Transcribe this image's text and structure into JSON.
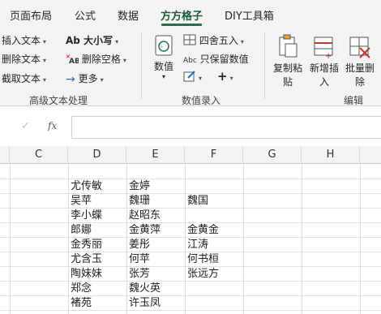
{
  "tabs": [
    "页面布局",
    "公式",
    "数据",
    "方方格子",
    "DIY工具箱"
  ],
  "ribbon": {
    "text_group": {
      "insert_text": "插入文本",
      "delete_text": "删除文本",
      "cut_text": "截取文本",
      "case_label": "Ab 大小写",
      "delete_space": "删除空格",
      "more": "更多",
      "group_label": "高级文本处理"
    },
    "numeric_group": {
      "value_label": "数值",
      "round_label": "四舍五入",
      "keep_value": "只保留数值",
      "group_label": "数值录入"
    },
    "edit_group": {
      "copy_paste": "复制粘",
      "copy_paste2": "贴",
      "add_insert": "新增插",
      "add_insert2": "入",
      "batch_delete": "批量删",
      "batch_delete2": "除",
      "group_label": "编辑"
    }
  },
  "formula_bar": {
    "cancel": "✓",
    "fx": "fx",
    "value": ""
  },
  "columns": [
    "C",
    "D",
    "E",
    "F",
    "G",
    "H"
  ],
  "rows": [
    [
      "",
      "尤传敏",
      "金婷",
      "",
      "",
      ""
    ],
    [
      "",
      "吴苹",
      "魏珊",
      "魏国",
      "",
      ""
    ],
    [
      "",
      "李小蝶",
      "赵昭东",
      "",
      "",
      ""
    ],
    [
      "",
      "郎娜",
      "金黄萍",
      "金黄金",
      "",
      ""
    ],
    [
      "",
      "金秀丽",
      "姜彤",
      "江涛",
      "",
      ""
    ],
    [
      "",
      "尤含玉",
      "何苹",
      "何书桓",
      "",
      ""
    ],
    [
      "",
      "陶妹妹",
      "张芳",
      "张远方",
      "",
      ""
    ],
    [
      "",
      "郑念",
      "魏火英",
      "",
      "",
      ""
    ],
    [
      "",
      "褚苑",
      "许玉凤",
      "",
      "",
      ""
    ]
  ]
}
